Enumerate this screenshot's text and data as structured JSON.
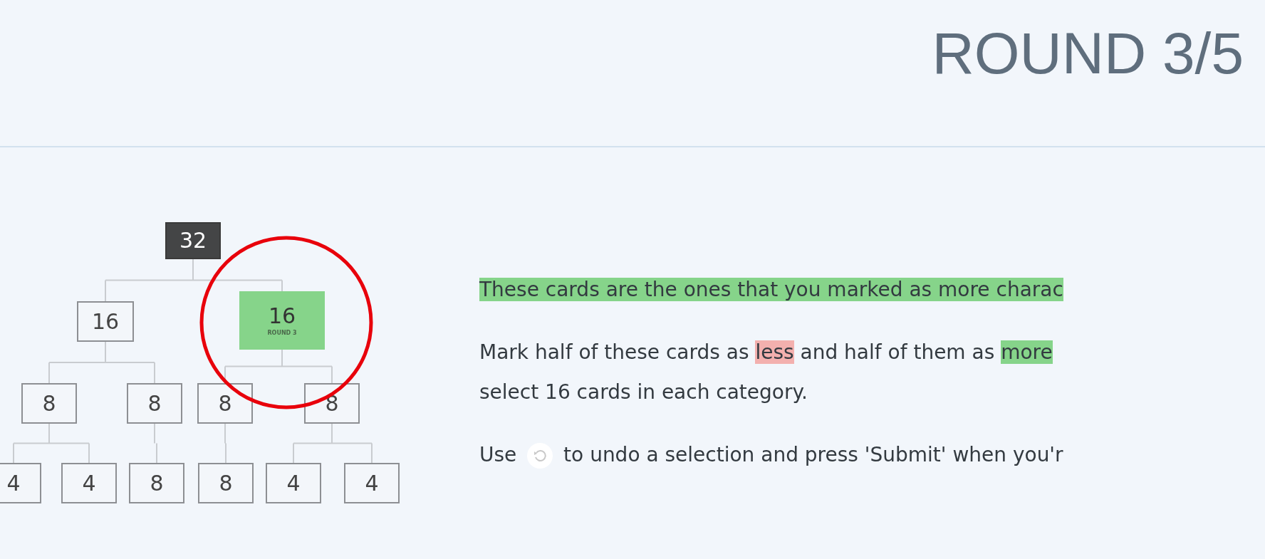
{
  "header": {
    "title": "ROUND 3/5"
  },
  "tree": {
    "value": "32",
    "kind": "done",
    "children": [
      {
        "value": "16",
        "kind": "open",
        "children": [
          {
            "value": "8",
            "kind": "open",
            "children": [
              {
                "value": "4",
                "kind": "open"
              },
              {
                "value": "4",
                "kind": "open"
              }
            ]
          },
          {
            "value": "8",
            "kind": "open",
            "children": [
              {
                "value": "8",
                "kind": "open"
              }
            ]
          }
        ]
      },
      {
        "value": "16",
        "kind": "current",
        "caption": "ROUND 3",
        "children": [
          {
            "value": "8",
            "kind": "open",
            "children": [
              {
                "value": "8",
                "kind": "open"
              }
            ]
          },
          {
            "value": "8",
            "kind": "open",
            "children": [
              {
                "value": "4",
                "kind": "open"
              },
              {
                "value": "4",
                "kind": "open"
              }
            ]
          }
        ]
      }
    ]
  },
  "instructions": [
    {
      "lines": [
        [
          {
            "kind": "text",
            "text": "These cards are the ones that you marked as more charac",
            "color": "#86d48a"
          }
        ]
      ]
    },
    {
      "lines": [
        [
          {
            "kind": "text",
            "text": "Mark half of these cards as "
          },
          {
            "kind": "text",
            "text": "less",
            "color": "#f3b0ae"
          },
          {
            "kind": "text",
            "text": " and half of them as "
          },
          {
            "kind": "text",
            "text": "more",
            "color": "#86d48a"
          }
        ],
        [
          {
            "kind": "text",
            "text": "select 16 cards in each category."
          }
        ]
      ]
    },
    {
      "lines": [
        [
          {
            "kind": "text",
            "text": "Use "
          },
          {
            "kind": "icon"
          },
          {
            "kind": "text",
            "text": " to undo a selection and press 'Submit' when you'r"
          }
        ]
      ]
    }
  ]
}
